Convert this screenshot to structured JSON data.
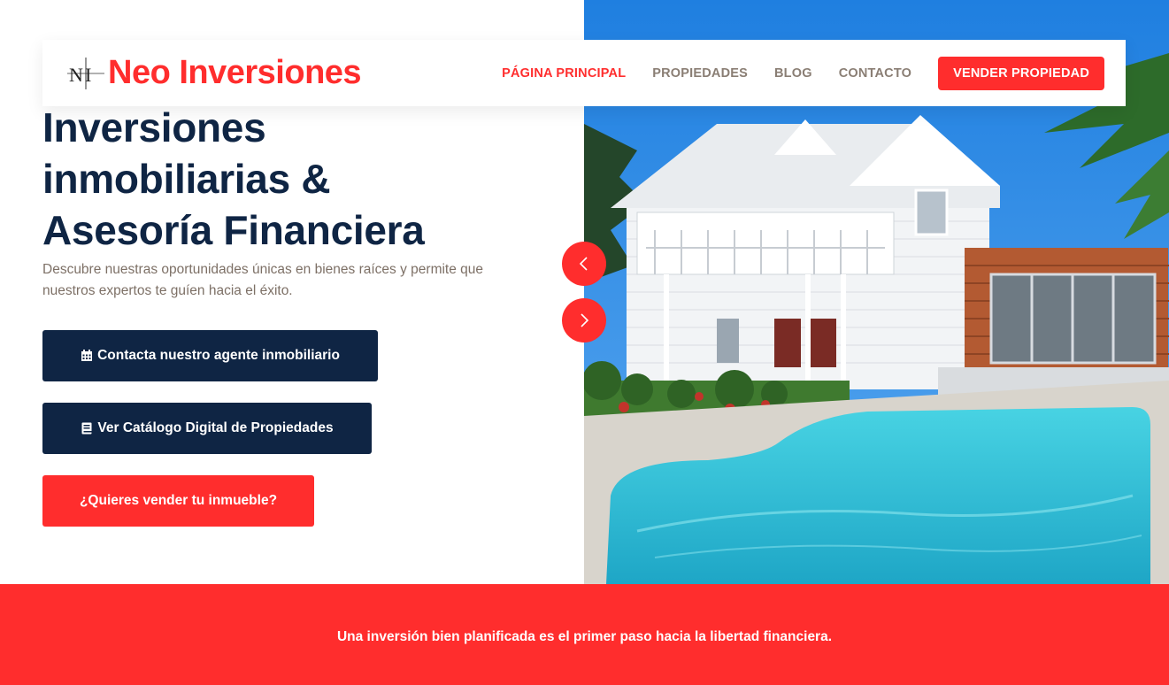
{
  "brand": {
    "name": "Neo Inversiones",
    "accent_color": "#ff2d2d",
    "navy_color": "#0f2544"
  },
  "nav": {
    "links": [
      {
        "label": "PÁGINA PRINCIPAL",
        "active": true
      },
      {
        "label": "PROPIEDADES",
        "active": false
      },
      {
        "label": "BLOG",
        "active": false
      },
      {
        "label": "CONTACTO",
        "active": false
      }
    ],
    "cta_label": "VENDER PROPIEDAD"
  },
  "hero": {
    "title_lines": [
      "Inversiones",
      "inmobiliarias &",
      "Asesoría Financiera"
    ],
    "subtitle": "Descubre nuestras oportunidades únicas en bienes raíces y permite que nuestros expertos te guíen hacia el éxito.",
    "buttons": {
      "agent": {
        "label": "Contacta nuestro agente inmobiliario",
        "icon": "calendar-icon"
      },
      "catalog": {
        "label": "Ver Catálogo Digital de Propiedades",
        "icon": "book-icon"
      },
      "sell": {
        "label": "¿Quieres vender tu inmueble?"
      }
    },
    "slider": {
      "prev_icon": "chevron-left-icon",
      "next_icon": "chevron-right-icon"
    }
  },
  "banner": {
    "text": "Una inversión bien planificada es el primer paso hacia la libertad financiera."
  }
}
